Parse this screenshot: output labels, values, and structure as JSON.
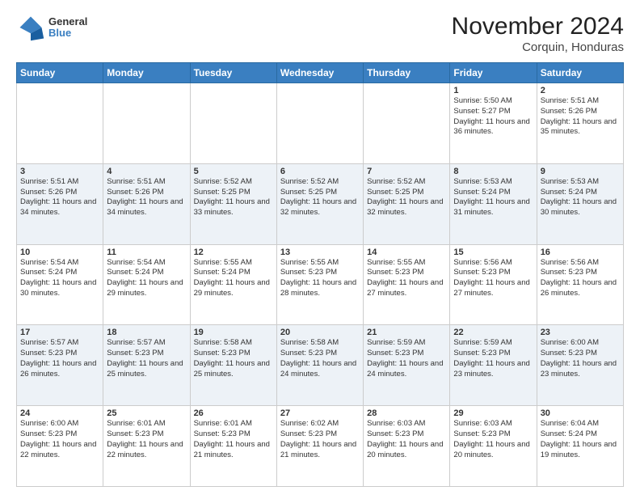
{
  "header": {
    "logo": {
      "general": "General",
      "blue": "Blue"
    },
    "title": "November 2024",
    "location": "Corquin, Honduras"
  },
  "calendar": {
    "days_of_week": [
      "Sunday",
      "Monday",
      "Tuesday",
      "Wednesday",
      "Thursday",
      "Friday",
      "Saturday"
    ],
    "weeks": [
      [
        {
          "day": "",
          "info": ""
        },
        {
          "day": "",
          "info": ""
        },
        {
          "day": "",
          "info": ""
        },
        {
          "day": "",
          "info": ""
        },
        {
          "day": "",
          "info": ""
        },
        {
          "day": "1",
          "info": "Sunrise: 5:50 AM\nSunset: 5:27 PM\nDaylight: 11 hours and 36 minutes."
        },
        {
          "day": "2",
          "info": "Sunrise: 5:51 AM\nSunset: 5:26 PM\nDaylight: 11 hours and 35 minutes."
        }
      ],
      [
        {
          "day": "3",
          "info": "Sunrise: 5:51 AM\nSunset: 5:26 PM\nDaylight: 11 hours and 34 minutes."
        },
        {
          "day": "4",
          "info": "Sunrise: 5:51 AM\nSunset: 5:26 PM\nDaylight: 11 hours and 34 minutes."
        },
        {
          "day": "5",
          "info": "Sunrise: 5:52 AM\nSunset: 5:25 PM\nDaylight: 11 hours and 33 minutes."
        },
        {
          "day": "6",
          "info": "Sunrise: 5:52 AM\nSunset: 5:25 PM\nDaylight: 11 hours and 32 minutes."
        },
        {
          "day": "7",
          "info": "Sunrise: 5:52 AM\nSunset: 5:25 PM\nDaylight: 11 hours and 32 minutes."
        },
        {
          "day": "8",
          "info": "Sunrise: 5:53 AM\nSunset: 5:24 PM\nDaylight: 11 hours and 31 minutes."
        },
        {
          "day": "9",
          "info": "Sunrise: 5:53 AM\nSunset: 5:24 PM\nDaylight: 11 hours and 30 minutes."
        }
      ],
      [
        {
          "day": "10",
          "info": "Sunrise: 5:54 AM\nSunset: 5:24 PM\nDaylight: 11 hours and 30 minutes."
        },
        {
          "day": "11",
          "info": "Sunrise: 5:54 AM\nSunset: 5:24 PM\nDaylight: 11 hours and 29 minutes."
        },
        {
          "day": "12",
          "info": "Sunrise: 5:55 AM\nSunset: 5:24 PM\nDaylight: 11 hours and 29 minutes."
        },
        {
          "day": "13",
          "info": "Sunrise: 5:55 AM\nSunset: 5:23 PM\nDaylight: 11 hours and 28 minutes."
        },
        {
          "day": "14",
          "info": "Sunrise: 5:55 AM\nSunset: 5:23 PM\nDaylight: 11 hours and 27 minutes."
        },
        {
          "day": "15",
          "info": "Sunrise: 5:56 AM\nSunset: 5:23 PM\nDaylight: 11 hours and 27 minutes."
        },
        {
          "day": "16",
          "info": "Sunrise: 5:56 AM\nSunset: 5:23 PM\nDaylight: 11 hours and 26 minutes."
        }
      ],
      [
        {
          "day": "17",
          "info": "Sunrise: 5:57 AM\nSunset: 5:23 PM\nDaylight: 11 hours and 26 minutes."
        },
        {
          "day": "18",
          "info": "Sunrise: 5:57 AM\nSunset: 5:23 PM\nDaylight: 11 hours and 25 minutes."
        },
        {
          "day": "19",
          "info": "Sunrise: 5:58 AM\nSunset: 5:23 PM\nDaylight: 11 hours and 25 minutes."
        },
        {
          "day": "20",
          "info": "Sunrise: 5:58 AM\nSunset: 5:23 PM\nDaylight: 11 hours and 24 minutes."
        },
        {
          "day": "21",
          "info": "Sunrise: 5:59 AM\nSunset: 5:23 PM\nDaylight: 11 hours and 24 minutes."
        },
        {
          "day": "22",
          "info": "Sunrise: 5:59 AM\nSunset: 5:23 PM\nDaylight: 11 hours and 23 minutes."
        },
        {
          "day": "23",
          "info": "Sunrise: 6:00 AM\nSunset: 5:23 PM\nDaylight: 11 hours and 23 minutes."
        }
      ],
      [
        {
          "day": "24",
          "info": "Sunrise: 6:00 AM\nSunset: 5:23 PM\nDaylight: 11 hours and 22 minutes."
        },
        {
          "day": "25",
          "info": "Sunrise: 6:01 AM\nSunset: 5:23 PM\nDaylight: 11 hours and 22 minutes."
        },
        {
          "day": "26",
          "info": "Sunrise: 6:01 AM\nSunset: 5:23 PM\nDaylight: 11 hours and 21 minutes."
        },
        {
          "day": "27",
          "info": "Sunrise: 6:02 AM\nSunset: 5:23 PM\nDaylight: 11 hours and 21 minutes."
        },
        {
          "day": "28",
          "info": "Sunrise: 6:03 AM\nSunset: 5:23 PM\nDaylight: 11 hours and 20 minutes."
        },
        {
          "day": "29",
          "info": "Sunrise: 6:03 AM\nSunset: 5:23 PM\nDaylight: 11 hours and 20 minutes."
        },
        {
          "day": "30",
          "info": "Sunrise: 6:04 AM\nSunset: 5:24 PM\nDaylight: 11 hours and 19 minutes."
        }
      ]
    ]
  }
}
